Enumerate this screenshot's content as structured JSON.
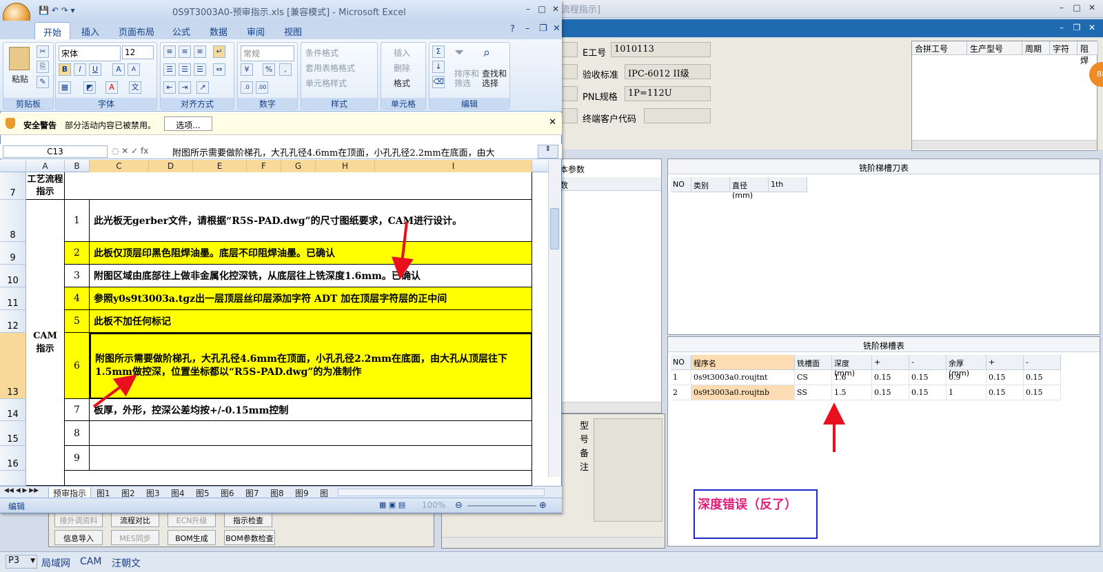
{
  "bg_app": {
    "title": "- [流程指示]",
    "form": {
      "e_code_label": "E工号",
      "e_code_value": "1010113",
      "accept_label": "验收标准",
      "accept_value": "IPC-6012 II级",
      "pnl_label": "PNL规格",
      "pnl_value": "1P=112U",
      "customer_label": "终端客户代码",
      "customer_value": "",
      "left_num": "8"
    },
    "right_grid_headers": [
      "合拼工号",
      "生产型号",
      "周期",
      "字符",
      "阻焊"
    ],
    "badge": "88",
    "basic_params_title": "基本参数",
    "basic_params_header": "参数",
    "basic_params_row": "/",
    "model_note_label": [
      "型",
      "号",
      "备",
      "注"
    ],
    "tool_table": {
      "title": "铣阶梯槽刀表",
      "headers": [
        "NO",
        "类别",
        "直径(mm)",
        "1th"
      ]
    },
    "slot_table": {
      "title": "铣阶梯槽表",
      "headers": [
        "NO",
        "程序名",
        "铣槽面",
        "深度(mm)",
        "+",
        "-",
        "余厚(mm)",
        "+",
        "-"
      ],
      "rows": [
        [
          "1",
          "0s9t3003a0.roujtnt",
          "CS",
          "1.6",
          "0.15",
          "0.15",
          "0.9",
          "0.15",
          "0.15"
        ],
        [
          "2",
          "0s9t3003a0.roujtnb",
          "SS",
          "1.5",
          "0.15",
          "0.15",
          "1",
          "0.15",
          "0.15"
        ]
      ]
    },
    "annotation": "深度错误（反了）",
    "buttons_row1": [
      "接外调资料",
      "流程对比",
      "ECN升级",
      "指示检查"
    ],
    "buttons_row2": [
      "信息导入",
      "MES同步",
      "BOM生成",
      "BOM参数检查"
    ],
    "status": {
      "p3": "P3",
      "items": [
        "局域网",
        "CAM",
        "汪朝文"
      ]
    }
  },
  "excel": {
    "title": "0S9T3003A0-预审指示.xls  [兼容模式] - Microsoft Excel",
    "tabs": [
      "开始",
      "插入",
      "页面布局",
      "公式",
      "数据",
      "审阅",
      "视图"
    ],
    "ribbon": {
      "paste": "粘贴",
      "clipboard": "剪贴板",
      "font_name": "宋体",
      "font_size": "12",
      "font_group": "字体",
      "align_group": "对齐方式",
      "number_format": "常规",
      "number_group": "数字",
      "cond_format": "条件格式",
      "table_format": "套用表格格式",
      "cell_style": "单元格样式",
      "style_group": "样式",
      "insert": "插入",
      "delete": "删除",
      "format": "格式",
      "cells_group": "单元格",
      "sort_filter": [
        "排序和",
        "筛选"
      ],
      "find_select": [
        "查找和",
        "选择"
      ],
      "edit_group": "编辑"
    },
    "security": {
      "title": "安全警告",
      "message": "部分活动内容已被禁用。",
      "options": "选项..."
    },
    "name_box": "C13",
    "formula": "附图所示需要做阶梯孔，大孔孔径4.6mm在顶面，小孔孔径2.2mm在底面，由大",
    "columns": [
      "A",
      "B",
      "C",
      "D",
      "E",
      "F",
      "G",
      "H",
      "I"
    ],
    "rows": [
      {
        "row": "7",
        "a": "工艺流程指示",
        "b": "",
        "c": ""
      },
      {
        "row": "8",
        "b": "1",
        "c": "此光板无gerber文件，请根据“R5S-PAD.dwg”的尺寸图纸要求，CAM进行设计。"
      },
      {
        "row": "9",
        "b": "2",
        "c": "此板仅顶层印黑色阻焊油墨。底层不印阻焊油墨。已确认"
      },
      {
        "row": "10",
        "b": "3",
        "c": "附图区域由底部往上做非金属化控深铣，从底层往上铣深度1.6mm。已确认"
      },
      {
        "row": "11",
        "b": "4",
        "c": "参照y0s9t3003a.tgz出一层顶层丝印层添加字符 ADT 加在顶层字符层的正中间"
      },
      {
        "row": "12",
        "b": "5",
        "c": "此板不加任何标记"
      },
      {
        "row": "13",
        "b": "6",
        "c": "附图所示需要做阶梯孔，大孔孔径4.6mm在顶面，小孔孔径2.2mm在底面，由大孔从顶层往下1.5mm做控深，位置坐标都以“R5S-PAD.dwg”的为准制作"
      },
      {
        "row": "14",
        "b": "7",
        "c": "板厚，外形，控深公差均按+/-0.15mm控制"
      },
      {
        "row": "15",
        "b": "8",
        "c": ""
      },
      {
        "row": "16",
        "b": "9",
        "c": ""
      }
    ],
    "cam_label": "CAM指示",
    "sheet_tabs": [
      "预审指示",
      "图1",
      "图2",
      "图3",
      "图4",
      "图5",
      "图6",
      "图7",
      "图8",
      "图9",
      "图"
    ],
    "status_mode": "编辑",
    "zoom": "100%"
  },
  "colors": {
    "highlight_yellow": "#ffff00",
    "arrow_red": "#e8101c",
    "annotation_pink": "#e0207a",
    "annotation_border": "#1a28c8"
  }
}
